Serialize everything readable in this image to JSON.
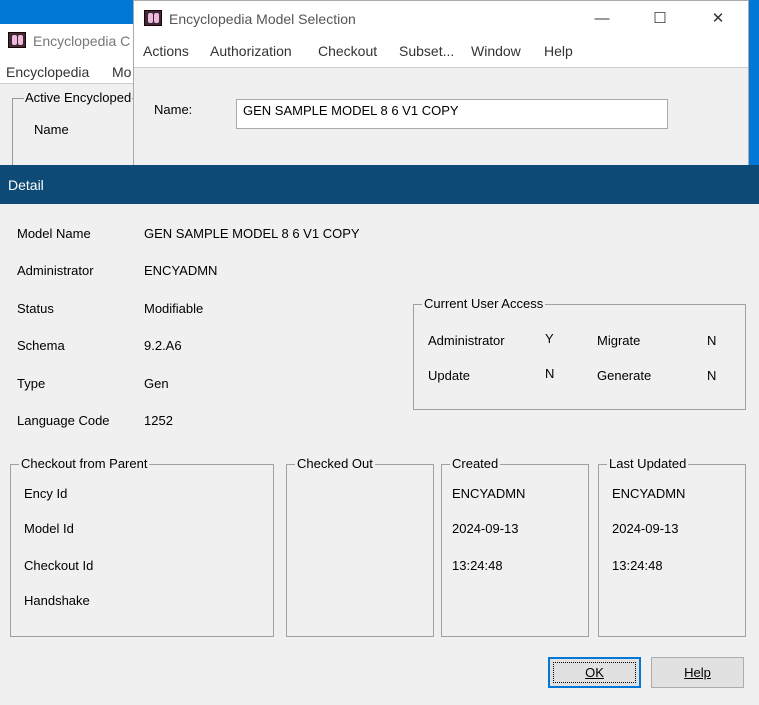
{
  "back_window": {
    "title": "Encyclopedia C",
    "menu": [
      "Encyclopedia",
      "Mo"
    ],
    "group_label": "Active Encycloped",
    "name_label": "Name"
  },
  "selection_window": {
    "title": "Encyclopedia Model Selection",
    "controls": {
      "minimize": "—",
      "maximize": "☐",
      "close": "✕"
    },
    "menu": [
      "Actions",
      "Authorization",
      "Checkout",
      "Subset...",
      "Window",
      "Help"
    ],
    "name_label": "Name:",
    "name_value": "GEN SAMPLE MODEL 8 6 V1 COPY"
  },
  "detail": {
    "title": "Detail",
    "fields": {
      "model_name": {
        "label": "Model Name",
        "value": "GEN SAMPLE MODEL 8 6 V1 COPY"
      },
      "administrator": {
        "label": "Administrator",
        "value": "ENCYADMN"
      },
      "status": {
        "label": "Status",
        "value": "Modifiable"
      },
      "schema": {
        "label": "Schema",
        "value": "9.2.A6"
      },
      "type": {
        "label": "Type",
        "value": "Gen"
      },
      "language_code": {
        "label": "Language Code",
        "value": "1252"
      }
    },
    "current_user_access": {
      "title": "Current User Access",
      "administrator": {
        "label": "Administrator",
        "value": "Y"
      },
      "update": {
        "label": "Update",
        "value": "N"
      },
      "migrate": {
        "label": "Migrate",
        "value": "N"
      },
      "generate": {
        "label": "Generate",
        "value": "N"
      }
    },
    "checkout_from_parent": {
      "title": "Checkout from Parent",
      "labels": [
        "Ency Id",
        "Model Id",
        "Checkout Id",
        "Handshake"
      ]
    },
    "checked_out": {
      "title": "Checked Out"
    },
    "created": {
      "title": "Created",
      "user": "ENCYADMN",
      "date": "2024-09-13",
      "time": "13:24:48"
    },
    "last_updated": {
      "title": "Last Updated",
      "user": "ENCYADMN",
      "date": "2024-09-13",
      "time": "13:24:48"
    },
    "buttons": {
      "ok": "OK",
      "help": "Help"
    }
  }
}
